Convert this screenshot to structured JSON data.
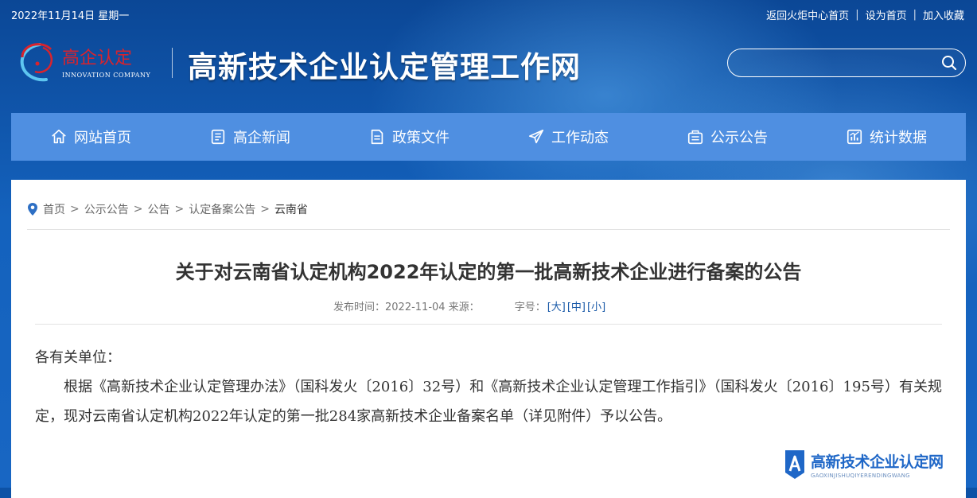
{
  "topbar": {
    "date": "2022年11月14日 星期一",
    "links": [
      "返回火炬中心首页",
      "设为首页",
      "加入收藏"
    ]
  },
  "header": {
    "logo_cn": "高企认定",
    "logo_en": "INNOVATION COMPANY",
    "site_title": "高新技术企业认定管理工作网",
    "search_placeholder": "",
    "search_icon": "search-icon"
  },
  "nav": {
    "items": [
      {
        "label": "网站首页",
        "icon": "home-icon"
      },
      {
        "label": "高企新闻",
        "icon": "news-icon"
      },
      {
        "label": "政策文件",
        "icon": "document-icon"
      },
      {
        "label": "工作动态",
        "icon": "paper-plane-icon"
      },
      {
        "label": "公示公告",
        "icon": "notice-icon"
      },
      {
        "label": "统计数据",
        "icon": "chart-icon"
      }
    ]
  },
  "breadcrumb": [
    "首页",
    "公示公告",
    "公告",
    "认定备案公告",
    "云南省"
  ],
  "article": {
    "title": "关于对云南省认定机构2022年认定的第一批高新技术企业进行备案的公告",
    "publish": "发布时间：2022-11-04 来源：",
    "font_size_label": "字号：",
    "font_sizes": [
      "[大]",
      "[中]",
      "[小]"
    ],
    "salutation": "各有关单位：",
    "paragraph": "根据《高新技术企业认定管理办法》（国科发火〔2016〕32号）和《高新技术企业认定管理工作指引》（国科发火〔2016〕195号）有关规定，现对云南省认定机构2022年认定的第一批284家高新技术企业备案名单（详见附件）予以公告。"
  },
  "watermark": {
    "main": "高新技术企业认定网",
    "sub": "GAOXINJISHUQIYERENDINGWANG"
  },
  "colors": {
    "header_blue": "#0d52a6",
    "nav_blue": "#4f8fe1",
    "link_blue": "#1a5aa8",
    "logo_red": "#d9232d"
  }
}
